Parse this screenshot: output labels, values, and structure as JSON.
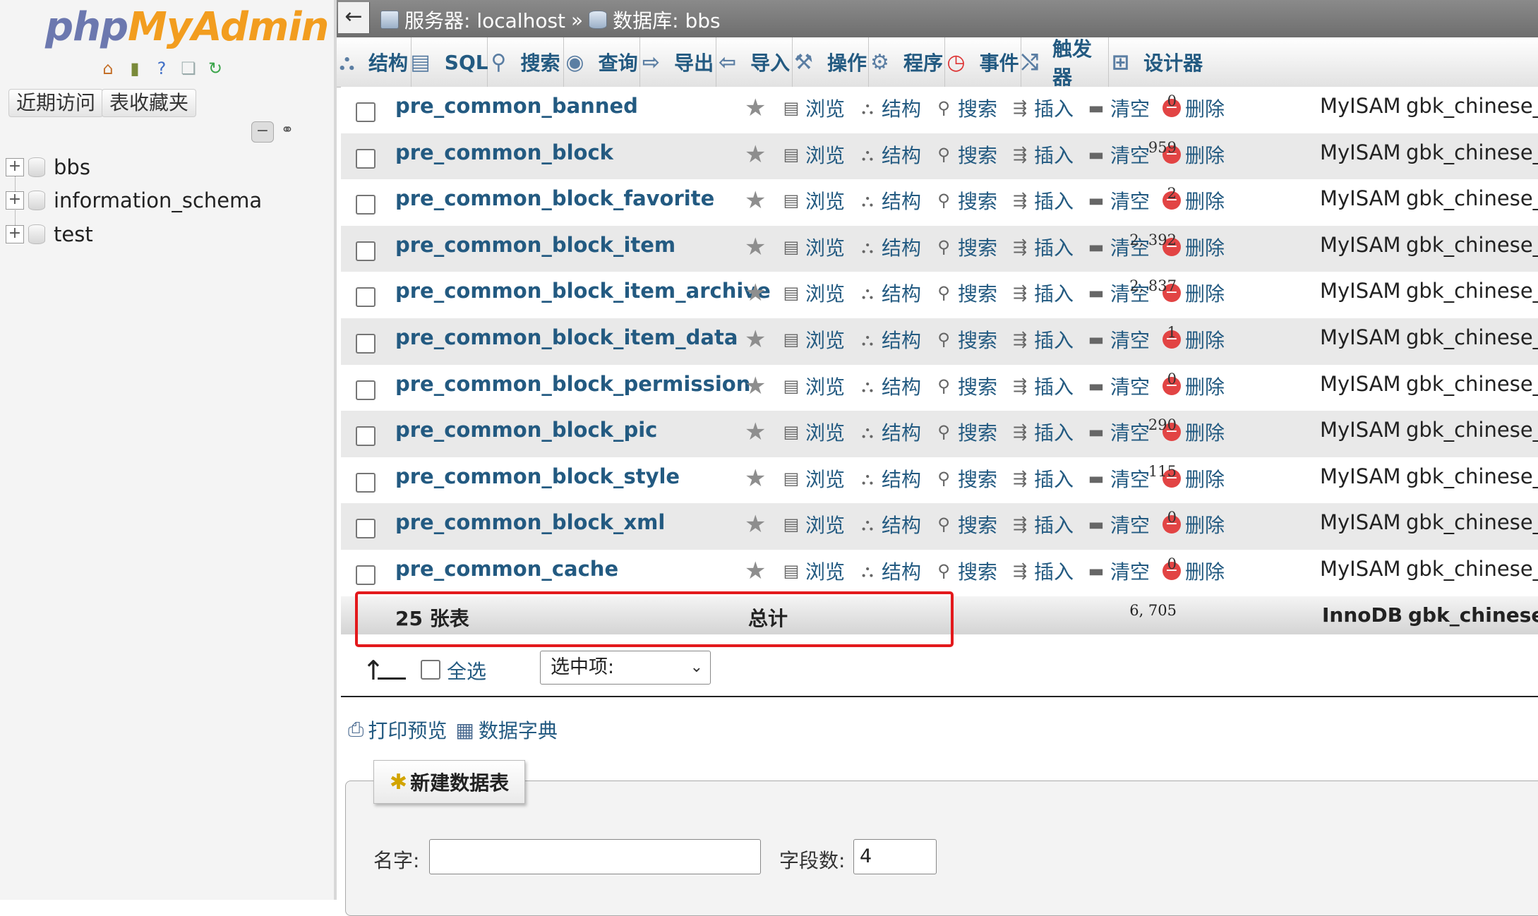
{
  "sidebar": {
    "logo_a": "php",
    "logo_b": "MyAdmin",
    "recent_btn": "近期访问",
    "favorites_btn": "表收藏夹",
    "collapse_glyph": "−",
    "link_glyph": "⚭",
    "databases": [
      {
        "name": "bbs"
      },
      {
        "name": "information_schema"
      },
      {
        "name": "test"
      }
    ]
  },
  "topbar": {
    "back": "←",
    "server_label": "服务器: localhost",
    "sep": "»",
    "db_label": "数据库: bbs"
  },
  "tabs": [
    {
      "label": "结构",
      "icon": "structure-icon"
    },
    {
      "label": "SQL",
      "icon": "sql-icon"
    },
    {
      "label": "搜索",
      "icon": "search-icon"
    },
    {
      "label": "查询",
      "icon": "query-icon"
    },
    {
      "label": "导出",
      "icon": "export-icon"
    },
    {
      "label": "导入",
      "icon": "import-icon"
    },
    {
      "label": "操作",
      "icon": "wrench-icon"
    },
    {
      "label": "程序",
      "icon": "routines-icon"
    },
    {
      "label": "事件",
      "icon": "clock-icon"
    },
    {
      "label": "触发器",
      "icon": "trigger-icon"
    },
    {
      "label": "设计器",
      "icon": "designer-icon"
    }
  ],
  "actions": {
    "browse": "浏览",
    "structure": "结构",
    "search": "搜索",
    "insert": "插入",
    "empty": "清空",
    "drop": "删除"
  },
  "tables": [
    {
      "name": "pre_common_banned",
      "rows": "0",
      "engine": "MyISAM",
      "collation": "gbk_chinese_ci"
    },
    {
      "name": "pre_common_block",
      "rows": "959",
      "engine": "MyISAM",
      "collation": "gbk_chinese_ci"
    },
    {
      "name": "pre_common_block_favorite",
      "rows": "2",
      "engine": "MyISAM",
      "collation": "gbk_chinese_ci"
    },
    {
      "name": "pre_common_block_item",
      "rows": "2, 392",
      "engine": "MyISAM",
      "collation": "gbk_chinese_ci"
    },
    {
      "name": "pre_common_block_item_archive",
      "rows": "2, 837",
      "engine": "MyISAM",
      "collation": "gbk_chinese_ci"
    },
    {
      "name": "pre_common_block_item_data",
      "rows": "1",
      "engine": "MyISAM",
      "collation": "gbk_chinese_ci"
    },
    {
      "name": "pre_common_block_permission",
      "rows": "0",
      "engine": "MyISAM",
      "collation": "gbk_chinese_ci"
    },
    {
      "name": "pre_common_block_pic",
      "rows": "290",
      "engine": "MyISAM",
      "collation": "gbk_chinese_ci"
    },
    {
      "name": "pre_common_block_style",
      "rows": "115",
      "engine": "MyISAM",
      "collation": "gbk_chinese_ci"
    },
    {
      "name": "pre_common_block_xml",
      "rows": "0",
      "engine": "MyISAM",
      "collation": "gbk_chinese_ci"
    },
    {
      "name": "pre_common_cache",
      "rows": "0",
      "engine": "MyISAM",
      "collation": "gbk_chinese_ci"
    }
  ],
  "summary": {
    "count_label": "25 张表",
    "total_label": "总计",
    "rows": "6, 705",
    "engine": "InnoDB",
    "collation": "gbk_chinese_c"
  },
  "bulk": {
    "check_all": "全选",
    "with_selected": "选中项:",
    "chevron": "⌄"
  },
  "links": {
    "print": "打印预览",
    "dictionary": "数据字典"
  },
  "create_table": {
    "legend": "新建数据表",
    "name_label": "名字:",
    "name_value": "",
    "cols_label": "字段数:",
    "cols_value": "4"
  },
  "colors": {
    "link": "#235a81",
    "highlight": "#e3191c",
    "row_even": "#e9e9e9"
  }
}
